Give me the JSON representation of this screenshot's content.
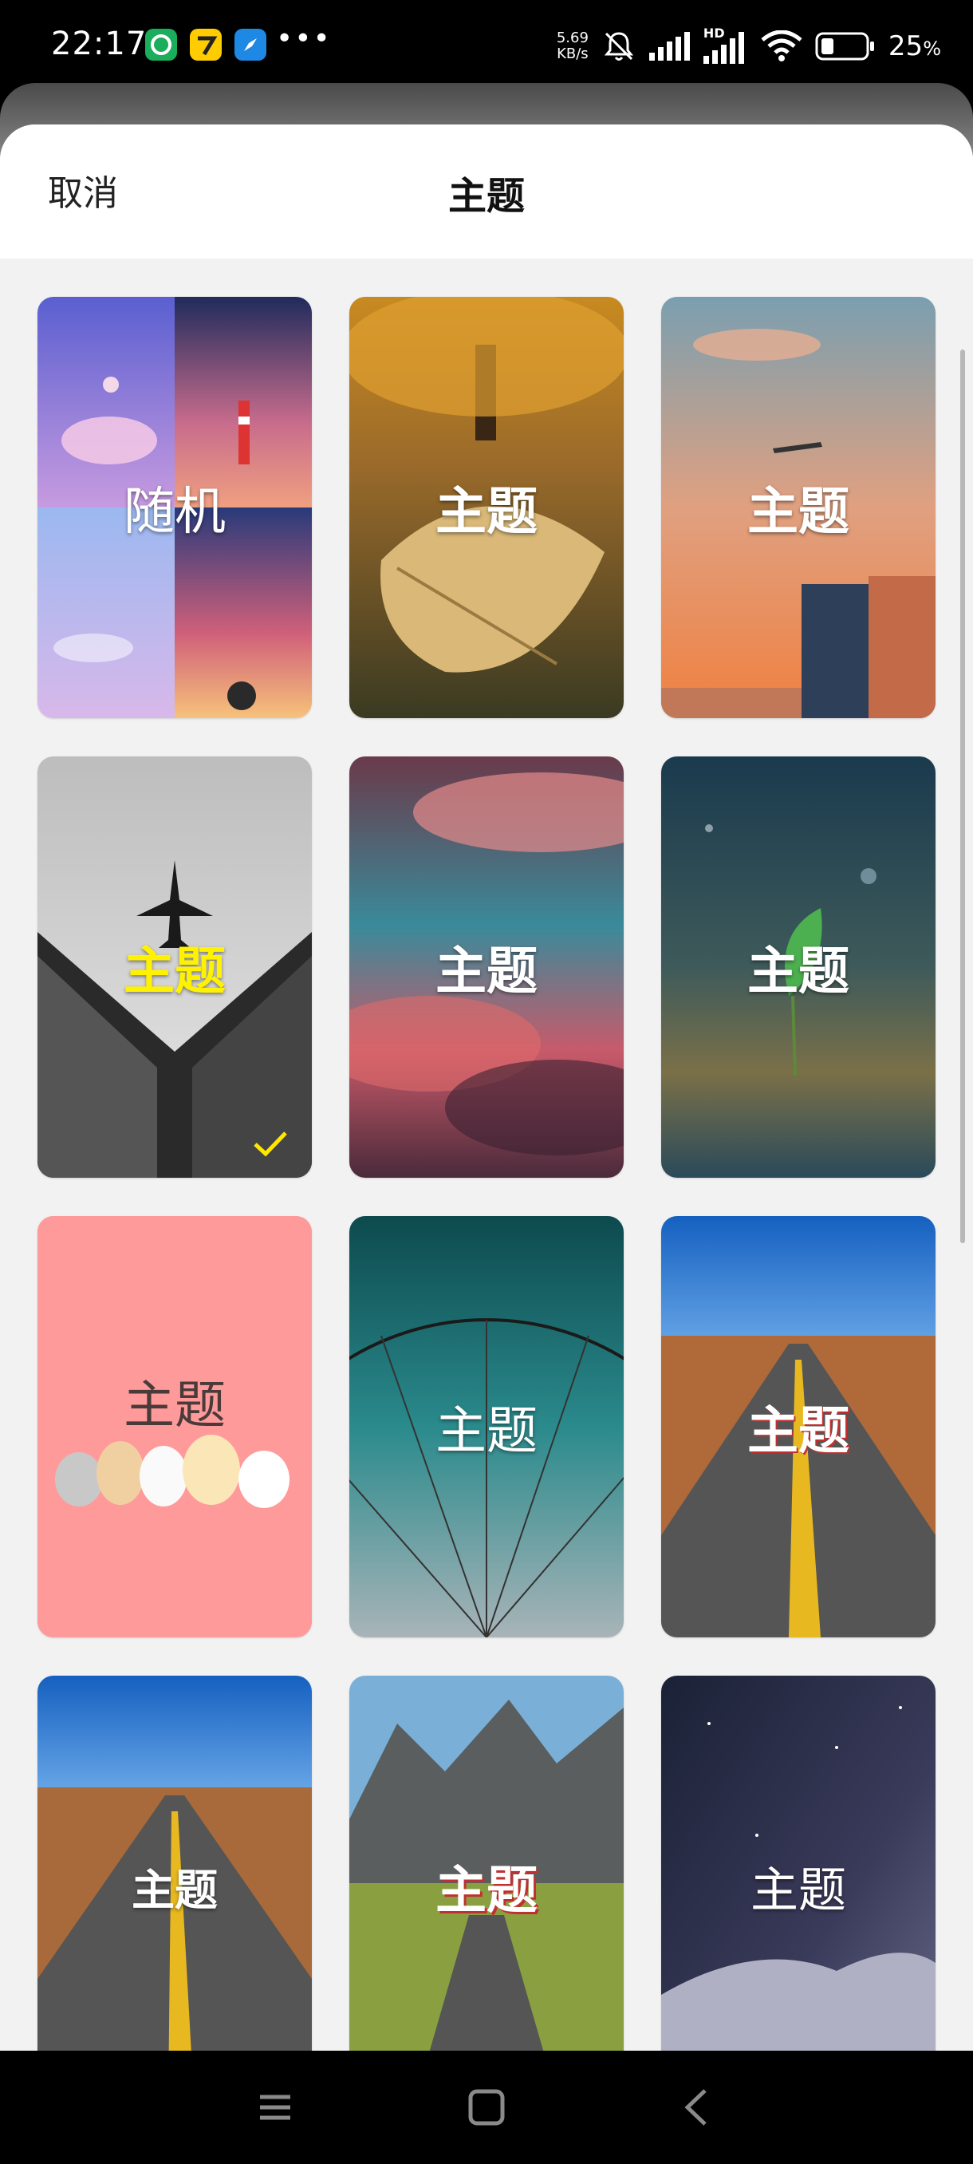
{
  "status_bar": {
    "time": "22:17",
    "network_speed_value": "5.69",
    "network_speed_unit": "KB/s",
    "signal_label": "HD",
    "battery_percent": "25",
    "battery_unit": "%"
  },
  "header": {
    "cancel_label": "取消",
    "title": "主题"
  },
  "themes": [
    {
      "label": "随机",
      "selected": false
    },
    {
      "label": "主题",
      "selected": false
    },
    {
      "label": "主题",
      "selected": false
    },
    {
      "label": "主题",
      "selected": true,
      "label_color": "#fff200"
    },
    {
      "label": "主题",
      "selected": false
    },
    {
      "label": "主题",
      "selected": false
    },
    {
      "label": "主题",
      "selected": false,
      "label_color": "#4a3a3a"
    },
    {
      "label": "主题",
      "selected": false
    },
    {
      "label": "主题",
      "selected": false
    },
    {
      "label": "主题",
      "selected": false
    },
    {
      "label": "主题",
      "selected": false
    },
    {
      "label": "主题",
      "selected": false
    }
  ],
  "colors": {
    "selected_label": "#fff200",
    "check": "#ffe800",
    "cat_tile_bg": "#ff9a9a"
  }
}
